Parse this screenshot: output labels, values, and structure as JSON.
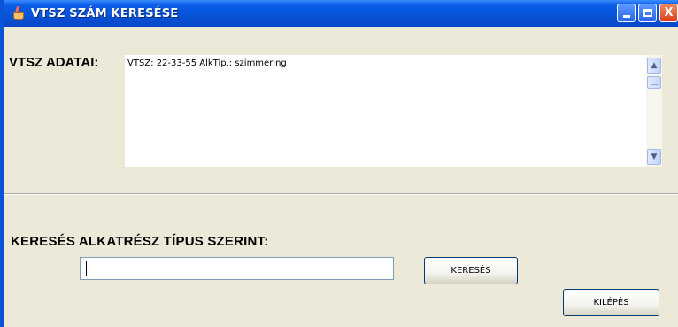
{
  "window": {
    "title": "VTSZ SZÁM KERESÉSE",
    "title_bar_color": "#0753d6",
    "controls": [
      "minimize-icon",
      "maximize-icon",
      "close-icon"
    ],
    "close_glyph": "X"
  },
  "details": {
    "label": "VTSZ ADATAI:",
    "content": "VTSZ: 22-33-55  AlkTip.: szimmering"
  },
  "search": {
    "label": "KERESÉS ALKATRÉSZ TÍPUS SZERINT:",
    "value": "",
    "button_label": "KERESÉS"
  },
  "exit": {
    "button_label": "KILÉPÉS"
  }
}
